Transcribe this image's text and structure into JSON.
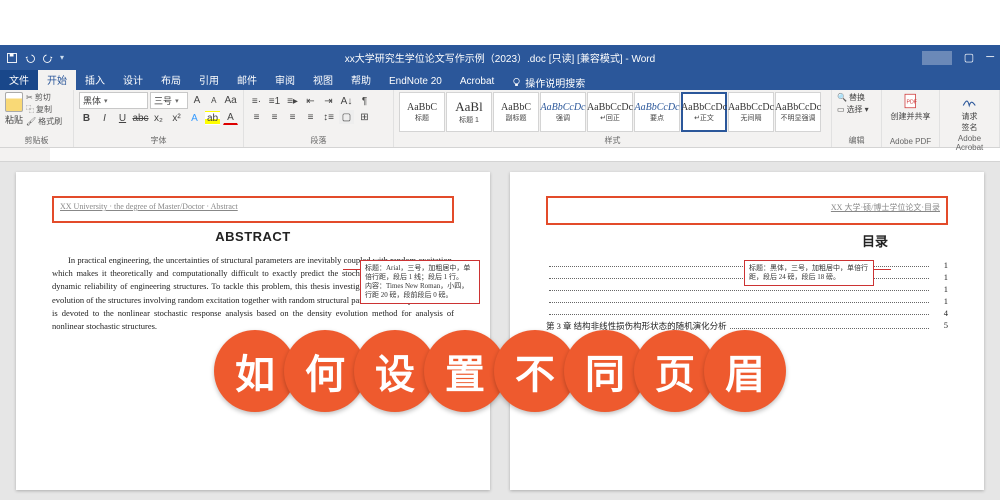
{
  "app": {
    "title": "xx大学研究生学位论文写作示例（2023）.doc [只读] [兼容模式] - Word"
  },
  "tabs": {
    "file": "文件",
    "items": [
      "开始",
      "插入",
      "设计",
      "布局",
      "引用",
      "邮件",
      "审阅",
      "视图",
      "帮助",
      "EndNote 20",
      "Acrobat"
    ],
    "active": "开始",
    "tellme": "操作说明搜索"
  },
  "ribbon": {
    "clipboard": {
      "label": "剪贴板",
      "paste": "粘贴",
      "cut": "剪切",
      "copy": "复制",
      "brush": "格式刷"
    },
    "font": {
      "label": "字体",
      "family": "黑体",
      "size": "三号"
    },
    "paragraph": {
      "label": "段落"
    },
    "styles": {
      "label": "样式",
      "items": [
        {
          "preview": "AaBbC",
          "name": "标题"
        },
        {
          "preview": "AaBl",
          "name": "标题 1"
        },
        {
          "preview": "AaBbC",
          "name": "副标题"
        },
        {
          "preview": "AaBbCcDc",
          "name": "强调"
        },
        {
          "preview": "AaBbCcDc",
          "name": "↵回正"
        },
        {
          "preview": "AaBbCcDc",
          "name": "要点"
        },
        {
          "preview": "AaBbCcDc",
          "name": "↵正文"
        },
        {
          "preview": "AaBbCcDc",
          "name": "无间隔"
        },
        {
          "preview": "AaBbCcDc",
          "name": "不明显强调"
        }
      ],
      "selectedIndex": 6
    },
    "editing": {
      "label": "编辑",
      "find": "替换",
      "select": "选择"
    },
    "adobe": {
      "label": "Adobe PDF",
      "btn": "创建并共享",
      "btn2": "签名"
    },
    "acrobat": {
      "label": "Adobe Acrobat",
      "btn": "请求\n签名"
    }
  },
  "page1": {
    "header": "XX University · the degree of Master/Doctor · Abstract",
    "title": "ABSTRACT",
    "callout": "标题：Arial，三号，加粗居中，单倍行距，段后 1 线；段后 1 行。\n内容：Times New Roman，小四，行距 20 磅，段前段后 0 磅。",
    "body": "In practical engineering, the uncertainties of structural parameters are inevitably coupled with random excitation, which makes it theoretically and computationally difficult to exactly predict the stochastic seismic response and dynamic reliability of engineering structures. To tackle this problem, this thesis investigates the probability density evolution of the structures involving random excitation together with random structural parameters. The present thesis is devoted to the nonlinear stochastic response analysis based on the density evolution method for analysis of nonlinear stochastic structures."
  },
  "page2": {
    "header": "XX 大学·硕/博士学位论文·目录",
    "title": "目录",
    "callout": "标题：黑体，三号，加粗居中，单倍行距，段后 24 磅，段后 18 磅。",
    "toc": [
      {
        "t": "",
        "p": "1"
      },
      {
        "t": "",
        "p": "1"
      },
      {
        "t": "",
        "p": "1"
      },
      {
        "t": "",
        "p": "1"
      },
      {
        "t": "",
        "p": "4"
      },
      {
        "t": "第 3 章  结构非线性损伤构形状态的随机演化分析",
        "p": "5"
      }
    ]
  },
  "overlay": {
    "chars": [
      "如",
      "何",
      "设",
      "置",
      "不",
      "同",
      "页",
      "眉"
    ]
  }
}
